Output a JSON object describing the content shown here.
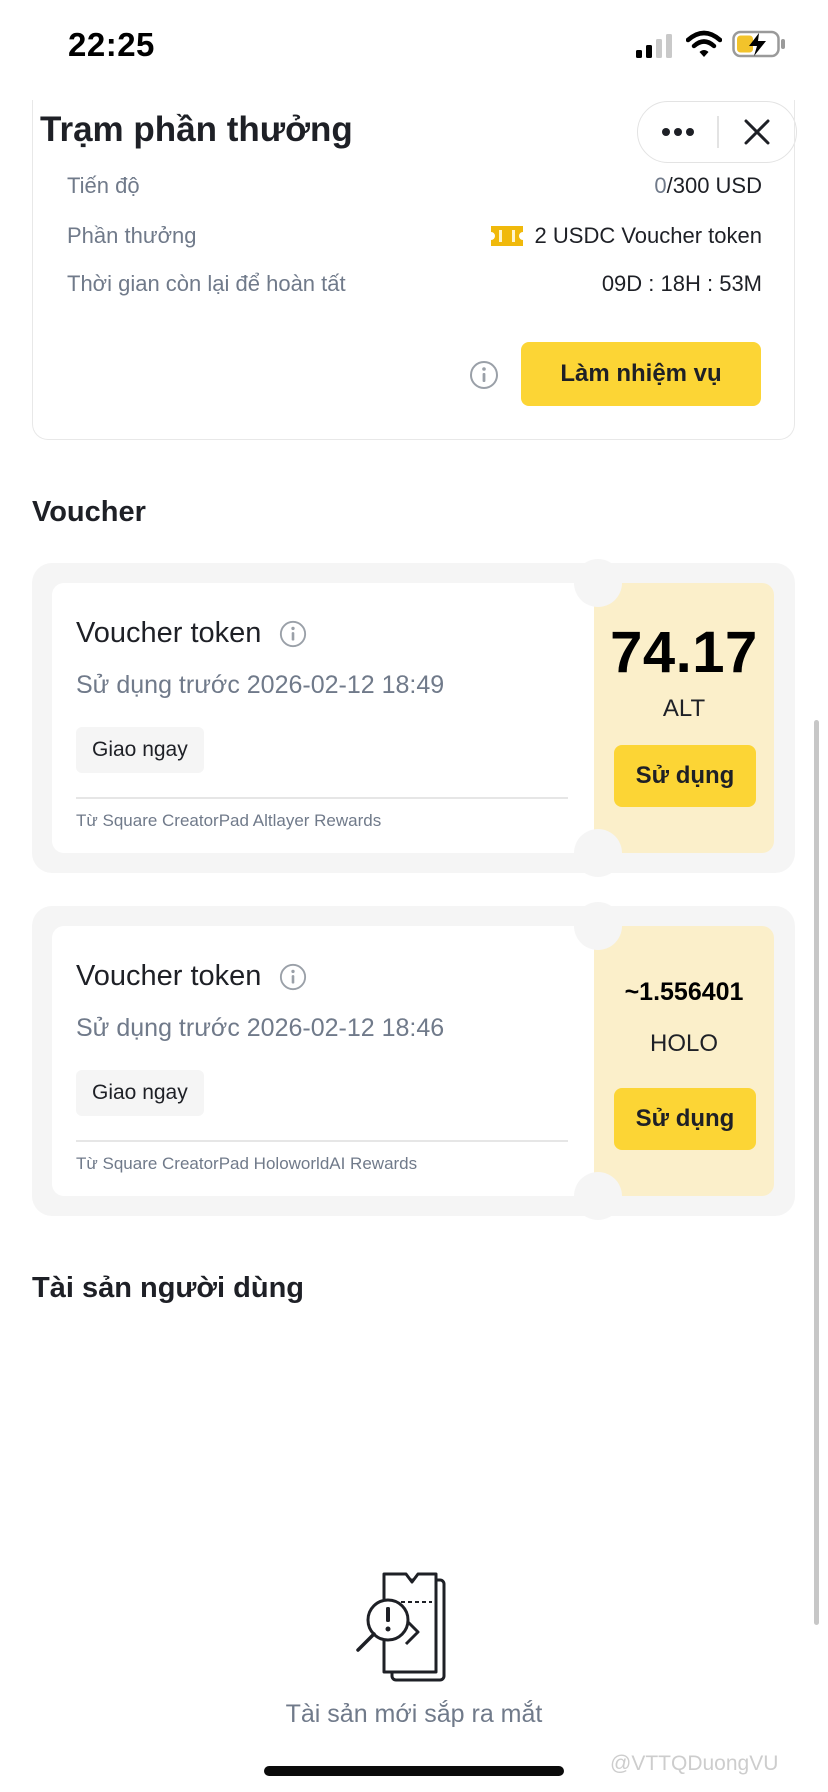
{
  "status_bar": {
    "time": "22:25"
  },
  "header": {
    "title": "Trạm phần thưởng"
  },
  "task": {
    "progress_label": "Tiến độ",
    "progress_current": "0",
    "progress_total": "/300 USD",
    "reward_label": "Phần thưởng",
    "reward_value": "2 USDC Voucher token",
    "time_left_label": "Thời gian còn lại để hoàn tất",
    "time_left_value": "09D : 18H : 53M",
    "action_label": "Làm nhiệm vụ"
  },
  "voucher_section": {
    "title": "Voucher"
  },
  "vouchers": [
    {
      "title": "Voucher token",
      "expiry": "Sử dụng trước 2026-02-12 18:49",
      "tag": "Giao ngay",
      "source": "Từ Square CreatorPad Altlayer Rewards",
      "amount": "74.17",
      "unit": "ALT",
      "use_label": "Sử dụng"
    },
    {
      "title": "Voucher token",
      "expiry": "Sử dụng trước 2026-02-12 18:46",
      "tag": "Giao ngay",
      "source": "Từ Square CreatorPad HoloworldAI Rewards",
      "amount": "~1.556401",
      "unit": "HOLO",
      "use_label": "Sử dụng"
    }
  ],
  "assets_section": {
    "title": "Tài sản người dùng",
    "empty_text": "Tài sản mới sắp ra mắt"
  },
  "watermark": "@VTTQDuongVU",
  "colors": {
    "accent": "#FCD535",
    "voucher_bg": "#FBEFCA",
    "muted_text": "#707A8A"
  },
  "icons": [
    "signal-icon",
    "wifi-icon",
    "battery-icon",
    "more-icon",
    "close-icon",
    "ticket-icon",
    "info-icon",
    "empty-assets-icon"
  ]
}
